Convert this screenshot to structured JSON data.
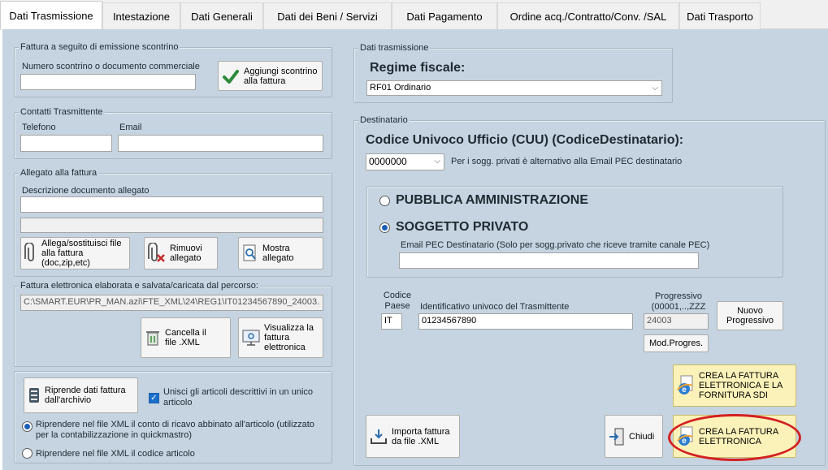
{
  "tabs": [
    "Dati Trasmissione",
    "Intestazione",
    "Dati Generali",
    "Dati dei Beni / Servizi",
    "Dati Pagamento",
    "Ordine acq./Contratto/Conv. /SAL",
    "Dati Trasporto"
  ],
  "scontrino": {
    "group_label": "Fattura a seguito di emissione scontrino",
    "field_label": "Numero scontrino o documento commerciale",
    "field_value": "",
    "add_button": "Aggiungi scontrino\nalla fattura"
  },
  "contatti": {
    "group_label": "Contatti Trasmittente",
    "telefono_label": "Telefono",
    "email_label": "Email",
    "telefono_value": "",
    "email_value": ""
  },
  "allegato": {
    "group_label": "Allegato alla fattura",
    "desc_label": "Descrizione documento allegato",
    "desc_value": "",
    "attach_button": "Allega/sostituisci file\nalla fattura\n(doc,zip,etc)",
    "remove_button": "Rimuovi\nallegato",
    "show_button": "Mostra\nallegato"
  },
  "percorso": {
    "group_label": "Fattura elettronica elaborata e salvata/caricata dal percorso:",
    "path_value": "C:\\SMART.EUR\\PR_MAN.azi\\FTE_XML\\24\\REG1\\IT01234567890_24003.",
    "delete_button": "Cancella il\nfile .XML",
    "view_button": "Visualizza la\nfattura\nelettronica"
  },
  "archivio": {
    "reload_button": "Riprende dati fattura\ndall'archivio",
    "merge_checkbox": "Unisci gli articoli descrittivi in un unico articolo",
    "radio_conto": "Riprendere nel file XML il  conto di ricavo abbinato all'articolo (utilizzato per la contabilizzazione in quickmastro)",
    "radio_codice": "Riprendere nel file XML il codice articolo"
  },
  "trasmissione": {
    "group_label": "Dati trasmissione",
    "regime_label": "Regime fiscale:",
    "regime_value": "RF01 Ordinario"
  },
  "destinatario": {
    "group_label": "Destinatario",
    "cuu_label": "Codice Univoco Ufficio (CUU) (CodiceDestinatario):",
    "cuu_value": "0000000",
    "cuu_hint": "Per i sogg. privati è alternativo alla Email PEC destinatario",
    "radio_pa": "PUBBLICA AMMINISTRAZIONE",
    "radio_privato": "SOGGETTO PRIVATO",
    "pec_label": "Email PEC Destinatario (Solo per sogg.privato che riceve tramite canale PEC)",
    "pec_value": ""
  },
  "trasmittente": {
    "codice_paese_label": "Codice\nPaese",
    "codice_paese_value": "IT",
    "id_label": "Identificativo univoco del Trasmittente",
    "id_value": "01234567890",
    "progressivo_label": "Progressivo\n(00001,..,ZZZ",
    "progressivo_value": "24003",
    "nuovo_button": "Nuovo\nProgressivo",
    "mod_button": "Mod.Progres."
  },
  "actions": {
    "importa_button": "Importa fattura\nda file .XML",
    "chiudi_button": "Chiudi",
    "crea_sdi_button": "CREA LA FATTURA\nELETTRONICA E LA\nFORNITURA SDI",
    "crea_button": "CREA LA FATTURA\nELETTRONICA"
  },
  "colors": {
    "panel_bg": "#c5d4e0",
    "highlight_ellipse": "#d42020",
    "yellow_button": "#fbf2b9"
  }
}
